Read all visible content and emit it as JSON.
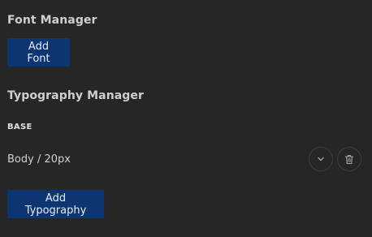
{
  "font_manager": {
    "title": "Font Manager",
    "add_button_label": "Add Font"
  },
  "typography_manager": {
    "title": "Typography Manager",
    "groups": [
      {
        "label": "BASE",
        "items": [
          {
            "label": "Body / 20px",
            "icons": [
              "chevron-down-icon",
              "trash-icon"
            ]
          }
        ]
      }
    ],
    "add_button_label": "Add Typography"
  },
  "colors": {
    "background": "#262626",
    "button_primary": "#0d3572",
    "text": "#cfcfcf",
    "icon_border": "#3f3f3f"
  }
}
